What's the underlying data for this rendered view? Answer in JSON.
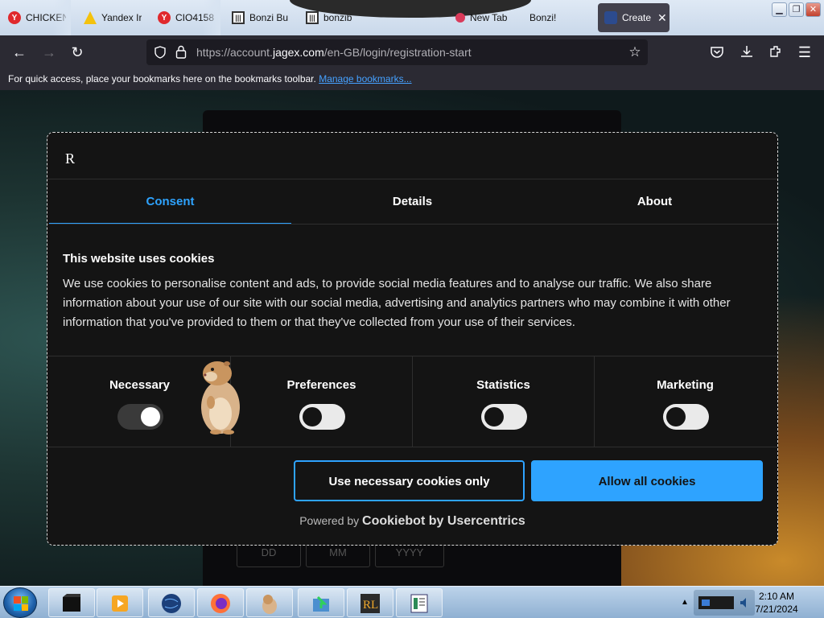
{
  "browser": {
    "tabs": [
      {
        "label": "CHICKEN",
        "icon": "yandex-icon"
      },
      {
        "label": "Yandex Ir",
        "icon": "yandex-images-icon"
      },
      {
        "label": "CIO4158",
        "icon": "yandex-icon"
      },
      {
        "label": "Bonzi Bu",
        "icon": "bonzi-icon"
      },
      {
        "label": "bonzib",
        "icon": "bonzi-icon"
      },
      {
        "label": "New Tab",
        "icon": "new-tab-icon"
      },
      {
        "label": "Bonzi!",
        "icon": "blank-icon"
      },
      {
        "label": "Create",
        "icon": "runescape-icon",
        "active": true
      }
    ],
    "url_prefix": "https://account.",
    "url_domain": "jagex.com",
    "url_path": "/en-GB/login/registration-start",
    "bookmarks_text": "For quick access, place your bookmarks here on the bookmarks toolbar.",
    "bookmarks_link": "Manage bookmarks..."
  },
  "background_form": {
    "fields": [
      "DD",
      "MM",
      "YYYY"
    ]
  },
  "cookie_dialog": {
    "logo": "R",
    "tabs": [
      {
        "label": "Consent",
        "active": true
      },
      {
        "label": "Details",
        "active": false
      },
      {
        "label": "About",
        "active": false
      }
    ],
    "title": "This website uses cookies",
    "body": "We use cookies to personalise content and ads, to provide social media features and to analyse our traffic. We also share information about your use of our site with our social media, advertising and analytics partners who may combine it with other information that you've provided to them or that they've collected from your use of their services.",
    "toggles": [
      {
        "label": "Necessary",
        "on": true
      },
      {
        "label": "Preferences",
        "on": false
      },
      {
        "label": "Statistics",
        "on": false
      },
      {
        "label": "Marketing",
        "on": false
      }
    ],
    "btn_necessary": "Use necessary cookies only",
    "btn_all": "Allow all cookies",
    "powered_prefix": "Powered by",
    "powered_brand": "Cookiebot by Usercentrics",
    "accent_color": "#2ea3ff"
  },
  "taskbar": {
    "time": "2:10 AM",
    "date": "7/21/2024"
  }
}
